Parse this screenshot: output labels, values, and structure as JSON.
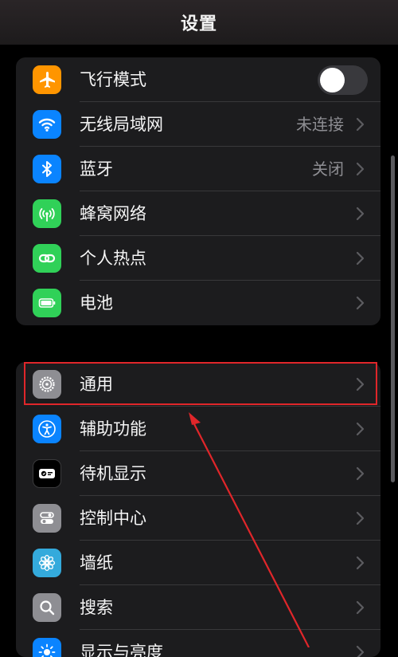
{
  "header": {
    "title": "设置"
  },
  "group1": [
    {
      "label": "飞行模式",
      "icon": "airplane-icon",
      "color": "#ff9500",
      "toggle": false
    },
    {
      "label": "无线局域网",
      "icon": "wifi-icon",
      "color": "#0a84ff",
      "value": "未连接"
    },
    {
      "label": "蓝牙",
      "icon": "bluetooth-icon",
      "color": "#0a84ff",
      "value": "关闭"
    },
    {
      "label": "蜂窝网络",
      "icon": "cellular-icon",
      "color": "#30d158"
    },
    {
      "label": "个人热点",
      "icon": "hotspot-icon",
      "color": "#30d158"
    },
    {
      "label": "电池",
      "icon": "battery-icon",
      "color": "#30d158"
    }
  ],
  "group2": [
    {
      "label": "通用",
      "icon": "gear-icon",
      "color": "#8e8e93"
    },
    {
      "label": "辅助功能",
      "icon": "accessibility-icon",
      "color": "#0a84ff"
    },
    {
      "label": "待机显示",
      "icon": "standby-icon",
      "color": "#1c1c1e"
    },
    {
      "label": "控制中心",
      "icon": "control-center-icon",
      "color": "#8e8e93"
    },
    {
      "label": "墙纸",
      "icon": "flower-icon",
      "color": "#34aadc"
    },
    {
      "label": "搜索",
      "icon": "search-icon",
      "color": "#8e8e93"
    },
    {
      "label": "显示与亮度",
      "icon": "brightness-icon",
      "color": "#0a84ff"
    }
  ],
  "colors": {
    "highlight": "#e0262a",
    "background": "#000000",
    "group": "#1c1c1e"
  }
}
